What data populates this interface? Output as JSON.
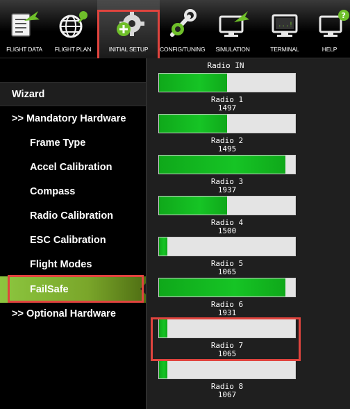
{
  "toolbar": {
    "buttons": [
      {
        "label": "FLIGHT DATA",
        "icon": "flight-data-icon"
      },
      {
        "label": "FLIGHT PLAN",
        "icon": "flight-plan-icon"
      },
      {
        "label": "INITIAL SETUP",
        "icon": "initial-setup-icon"
      },
      {
        "label": "CONFIG/TUNING",
        "icon": "config-tuning-icon"
      },
      {
        "label": "SIMULATION",
        "icon": "simulation-icon"
      },
      {
        "label": "TERMINAL",
        "icon": "terminal-icon"
      },
      {
        "label": "HELP",
        "icon": "help-icon"
      }
    ],
    "active": "INITIAL SETUP",
    "colors": {
      "accent": "#8cc63f",
      "highlight": "#e0443e"
    }
  },
  "sidebar": {
    "wizard": "Wizard",
    "mandatory": ">> Mandatory Hardware",
    "items": [
      {
        "label": "Frame Type"
      },
      {
        "label": "Accel Calibration"
      },
      {
        "label": "Compass"
      },
      {
        "label": "Radio Calibration"
      },
      {
        "label": "ESC Calibration"
      },
      {
        "label": "Flight Modes"
      },
      {
        "label": "FailSafe"
      }
    ],
    "optional": ">> Optional Hardware"
  },
  "panel": {
    "title": "Radio IN",
    "radios": [
      {
        "label": "Radio 1",
        "value": "1497",
        "fill": 0.5
      },
      {
        "label": "Radio 2",
        "value": "1495",
        "fill": 0.5
      },
      {
        "label": "Radio 3",
        "value": "1937",
        "fill": 0.93
      },
      {
        "label": "Radio 4",
        "value": "1500",
        "fill": 0.5
      },
      {
        "label": "Radio 5",
        "value": "1065",
        "fill": 0.06
      },
      {
        "label": "Radio 6",
        "value": "1931",
        "fill": 0.93
      },
      {
        "label": "Radio 7",
        "value": "1065",
        "fill": 0.06
      },
      {
        "label": "Radio 8",
        "value": "1067",
        "fill": 0.06
      }
    ]
  }
}
